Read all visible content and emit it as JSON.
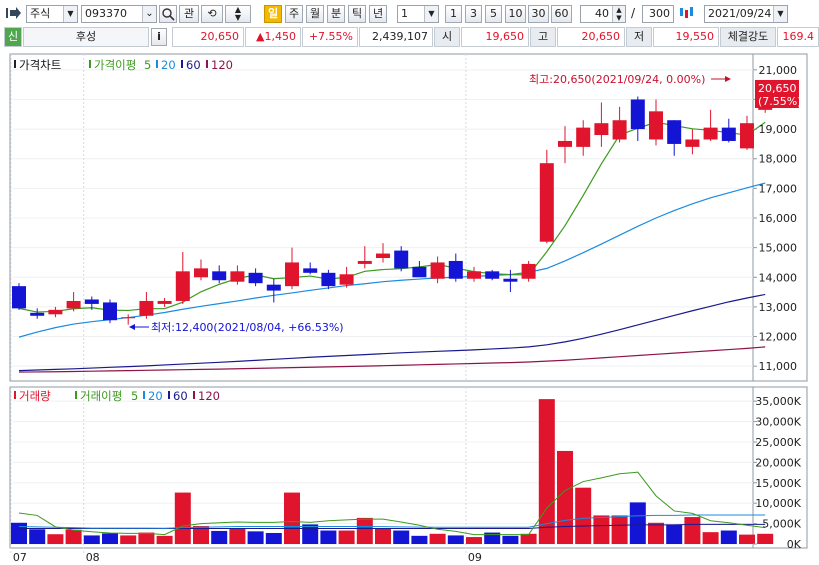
{
  "toolbar": {
    "market": "주식",
    "code": "093370",
    "btn_gwan": "관",
    "periods": [
      "일",
      "주",
      "월",
      "분",
      "틱",
      "년"
    ],
    "active_period": "일",
    "interval": "1",
    "quick": [
      "1",
      "3",
      "5",
      "10",
      "30",
      "60"
    ],
    "count_shown": "40",
    "slash": "/",
    "count_total": "300",
    "date": "2021/09/24"
  },
  "quote": {
    "badge": "신",
    "name": "후성",
    "info_btn": "i",
    "price": "20,650",
    "change": "▲1,450",
    "change_pct": "+7.55%",
    "volume": "2,439,107",
    "open_label": "시",
    "open": "19,650",
    "high_label": "고",
    "high": "20,650",
    "low_label": "저",
    "low": "19,550",
    "strength_label": "체결강도",
    "strength": "169.4"
  },
  "price_panel": {
    "legend": {
      "title": "가격차트",
      "ma": "가격이평",
      "ma_periods": [
        "5",
        "20",
        "60",
        "120"
      ]
    },
    "high_note": "최고:20,650(2021/09/24, 0.00%)",
    "low_note": "최저:12,400(2021/08/04, +66.53%)",
    "last_price": "20,650",
    "last_pct": "(7.55%)",
    "axis_ticks": [
      "21,000",
      "20,000",
      "19,000",
      "18,000",
      "17,000",
      "16,000",
      "15,000",
      "14,000",
      "13,000",
      "12,000",
      "11,000"
    ]
  },
  "volume_panel": {
    "legend": {
      "title": "거래량",
      "ma": "거래이평",
      "ma_periods": [
        "5",
        "20",
        "60",
        "120"
      ]
    },
    "axis_ticks": [
      "35,000K",
      "30,000K",
      "25,000K",
      "20,000K",
      "15,000K",
      "10,000K",
      "5,000K",
      "0K"
    ]
  },
  "x_labels": [
    {
      "index": 0,
      "text": "07"
    },
    {
      "index": 4,
      "text": "08"
    },
    {
      "index": 25,
      "text": "09"
    }
  ],
  "colors": {
    "up": "#e0142c",
    "down": "#1414d4",
    "ma5": "#3c9a1e",
    "ma20": "#1b8be0",
    "ma60": "#1a1a8c",
    "ma120": "#8c1448",
    "accent": "#f5b800"
  },
  "chart_data": {
    "type": "candlestick",
    "x_labels": [
      "07",
      "08",
      "09"
    ],
    "ylim": [
      10600,
      21400
    ],
    "vol_ylim": [
      0,
      37000
    ],
    "candles": [
      {
        "o": 13700,
        "h": 13800,
        "l": 12900,
        "c": 12950
      },
      {
        "o": 12800,
        "h": 12950,
        "l": 12600,
        "c": 12700
      },
      {
        "o": 12750,
        "h": 13000,
        "l": 12650,
        "c": 12900
      },
      {
        "o": 12950,
        "h": 13500,
        "l": 12850,
        "c": 13200
      },
      {
        "o": 13250,
        "h": 13350,
        "l": 12900,
        "c": 13100
      },
      {
        "o": 13150,
        "h": 13250,
        "l": 12450,
        "c": 12550
      },
      {
        "o": 12650,
        "h": 12750,
        "l": 12400,
        "c": 12650
      },
      {
        "o": 12700,
        "h": 13500,
        "l": 12600,
        "c": 13200
      },
      {
        "o": 13100,
        "h": 13300,
        "l": 13000,
        "c": 13200
      },
      {
        "o": 13200,
        "h": 14850,
        "l": 13100,
        "c": 14200
      },
      {
        "o": 14000,
        "h": 14600,
        "l": 13900,
        "c": 14300
      },
      {
        "o": 14200,
        "h": 14400,
        "l": 13800,
        "c": 13900
      },
      {
        "o": 13850,
        "h": 14400,
        "l": 13750,
        "c": 14200
      },
      {
        "o": 14150,
        "h": 14300,
        "l": 13700,
        "c": 13800
      },
      {
        "o": 13750,
        "h": 13950,
        "l": 13150,
        "c": 13550
      },
      {
        "o": 13700,
        "h": 15000,
        "l": 13600,
        "c": 14500
      },
      {
        "o": 14300,
        "h": 14500,
        "l": 14100,
        "c": 14150
      },
      {
        "o": 14150,
        "h": 14250,
        "l": 13600,
        "c": 13700
      },
      {
        "o": 13750,
        "h": 14350,
        "l": 13650,
        "c": 14100
      },
      {
        "o": 14450,
        "h": 15050,
        "l": 14300,
        "c": 14550
      },
      {
        "o": 14650,
        "h": 15150,
        "l": 14500,
        "c": 14800
      },
      {
        "o": 14900,
        "h": 15050,
        "l": 14200,
        "c": 14300
      },
      {
        "o": 14350,
        "h": 14550,
        "l": 14150,
        "c": 14000
      },
      {
        "o": 13950,
        "h": 14700,
        "l": 13800,
        "c": 14500
      },
      {
        "o": 14550,
        "h": 14800,
        "l": 13850,
        "c": 13950
      },
      {
        "o": 13950,
        "h": 14350,
        "l": 13850,
        "c": 14200
      },
      {
        "o": 14200,
        "h": 14250,
        "l": 13900,
        "c": 13950
      },
      {
        "o": 13950,
        "h": 14250,
        "l": 13500,
        "c": 13850
      },
      {
        "o": 13950,
        "h": 14550,
        "l": 13850,
        "c": 14450
      },
      {
        "o": 15200,
        "h": 18300,
        "l": 15150,
        "c": 17850
      },
      {
        "o": 18400,
        "h": 19100,
        "l": 17850,
        "c": 18600
      },
      {
        "o": 18400,
        "h": 19300,
        "l": 18100,
        "c": 19050
      },
      {
        "o": 18800,
        "h": 19900,
        "l": 18400,
        "c": 19200
      },
      {
        "o": 18650,
        "h": 19750,
        "l": 18550,
        "c": 19300
      },
      {
        "o": 20000,
        "h": 20100,
        "l": 18600,
        "c": 19000
      },
      {
        "o": 18650,
        "h": 20000,
        "l": 18450,
        "c": 19600
      },
      {
        "o": 19300,
        "h": 19300,
        "l": 18100,
        "c": 18500
      },
      {
        "o": 18400,
        "h": 19000,
        "l": 18150,
        "c": 18650
      },
      {
        "o": 18650,
        "h": 19650,
        "l": 18600,
        "c": 19050
      },
      {
        "o": 19050,
        "h": 19350,
        "l": 18550,
        "c": 18600
      },
      {
        "o": 18350,
        "h": 19450,
        "l": 18300,
        "c": 19200
      },
      {
        "o": 19650,
        "h": 20650,
        "l": 19550,
        "c": 20650
      }
    ],
    "volume": [
      5200,
      3600,
      2400,
      3500,
      2100,
      2600,
      2100,
      2800,
      2000,
      12600,
      4400,
      3200,
      3900,
      3100,
      2700,
      12600,
      4800,
      3300,
      3300,
      6400,
      3700,
      3300,
      2000,
      2500,
      2100,
      1700,
      2800,
      2000,
      2500,
      35500,
      22800,
      13800,
      7000,
      7000,
      10200,
      5200,
      4800,
      6600,
      2900,
      3300,
      2300,
      2500
    ],
    "ma": {
      "price": {
        "ma5_start": 2,
        "ma20_start": 0,
        "ma60_start": 0,
        "ma120_start": 0
      },
      "ma20": [
        11980,
        12150,
        12300,
        12420,
        12500,
        12570,
        12640,
        12720,
        12810,
        12920,
        13020,
        13110,
        13200,
        13300,
        13390,
        13470,
        13560,
        13640,
        13720,
        13780,
        13850,
        13900,
        13940,
        13980,
        14000,
        14030,
        14060,
        14090,
        14170,
        14300,
        14550,
        14830,
        15120,
        15420,
        15720,
        16000,
        16250,
        16480,
        16680,
        16850,
        17020,
        17180
      ],
      "ma60": [
        10850,
        10870,
        10890,
        10910,
        10935,
        10960,
        10985,
        11010,
        11040,
        11070,
        11100,
        11130,
        11160,
        11195,
        11230,
        11265,
        11300,
        11330,
        11360,
        11390,
        11420,
        11450,
        11475,
        11500,
        11525,
        11550,
        11580,
        11610,
        11650,
        11720,
        11820,
        11940,
        12080,
        12230,
        12390,
        12550,
        12710,
        12870,
        13020,
        13170,
        13300,
        13420
      ],
      "ma120": [
        10800,
        10805,
        10812,
        10820,
        10830,
        10840,
        10850,
        10860,
        10870,
        10880,
        10890,
        10900,
        10912,
        10925,
        10938,
        10950,
        10962,
        10975,
        10988,
        11000,
        11015,
        11030,
        11045,
        11060,
        11075,
        11090,
        11105,
        11120,
        11140,
        11170,
        11200,
        11240,
        11280,
        11320,
        11360,
        11400,
        11440,
        11480,
        11520,
        11560,
        11600,
        11650
      ]
    },
    "vol_ma5": [
      7600,
      7000,
      4200,
      3400,
      3000,
      2700,
      2600,
      2600,
      2300,
      4400,
      5000,
      5200,
      5400,
      5300,
      5300,
      5500,
      5300,
      5700,
      5900,
      6100,
      6100,
      5400,
      4600,
      3600,
      3100,
      2300,
      2300,
      2300,
      2300,
      8800,
      13100,
      15300,
      16200,
      17200,
      17600,
      11800,
      8100,
      7500,
      5700,
      5200,
      4600,
      4000
    ],
    "vol_ma20": [
      4300,
      4200,
      4100,
      4000,
      3900,
      3900,
      3900,
      3900,
      3850,
      4000,
      4100,
      4200,
      4300,
      4300,
      4300,
      4300,
      4300,
      4300,
      4300,
      4300,
      4250,
      4200,
      4150,
      4100,
      4100,
      4100,
      4100,
      4100,
      4100,
      5000,
      5800,
      6300,
      6500,
      6700,
      6900,
      7000,
      7000,
      7100,
      7100,
      7100,
      7100,
      7100
    ],
    "vol_ma60": [
      3800,
      3800,
      3800,
      3800,
      3800,
      3800,
      3800,
      3800,
      3800,
      3800,
      3800,
      3800,
      3800,
      3800,
      3800,
      3800,
      3800,
      3800,
      3800,
      3800,
      3800,
      3800,
      3800,
      3800,
      3800,
      3800,
      3800,
      3800,
      3800,
      4100,
      4300,
      4400,
      4500,
      4600,
      4700,
      4700,
      4700,
      4800,
      4800,
      4800,
      4800,
      4800
    ]
  }
}
